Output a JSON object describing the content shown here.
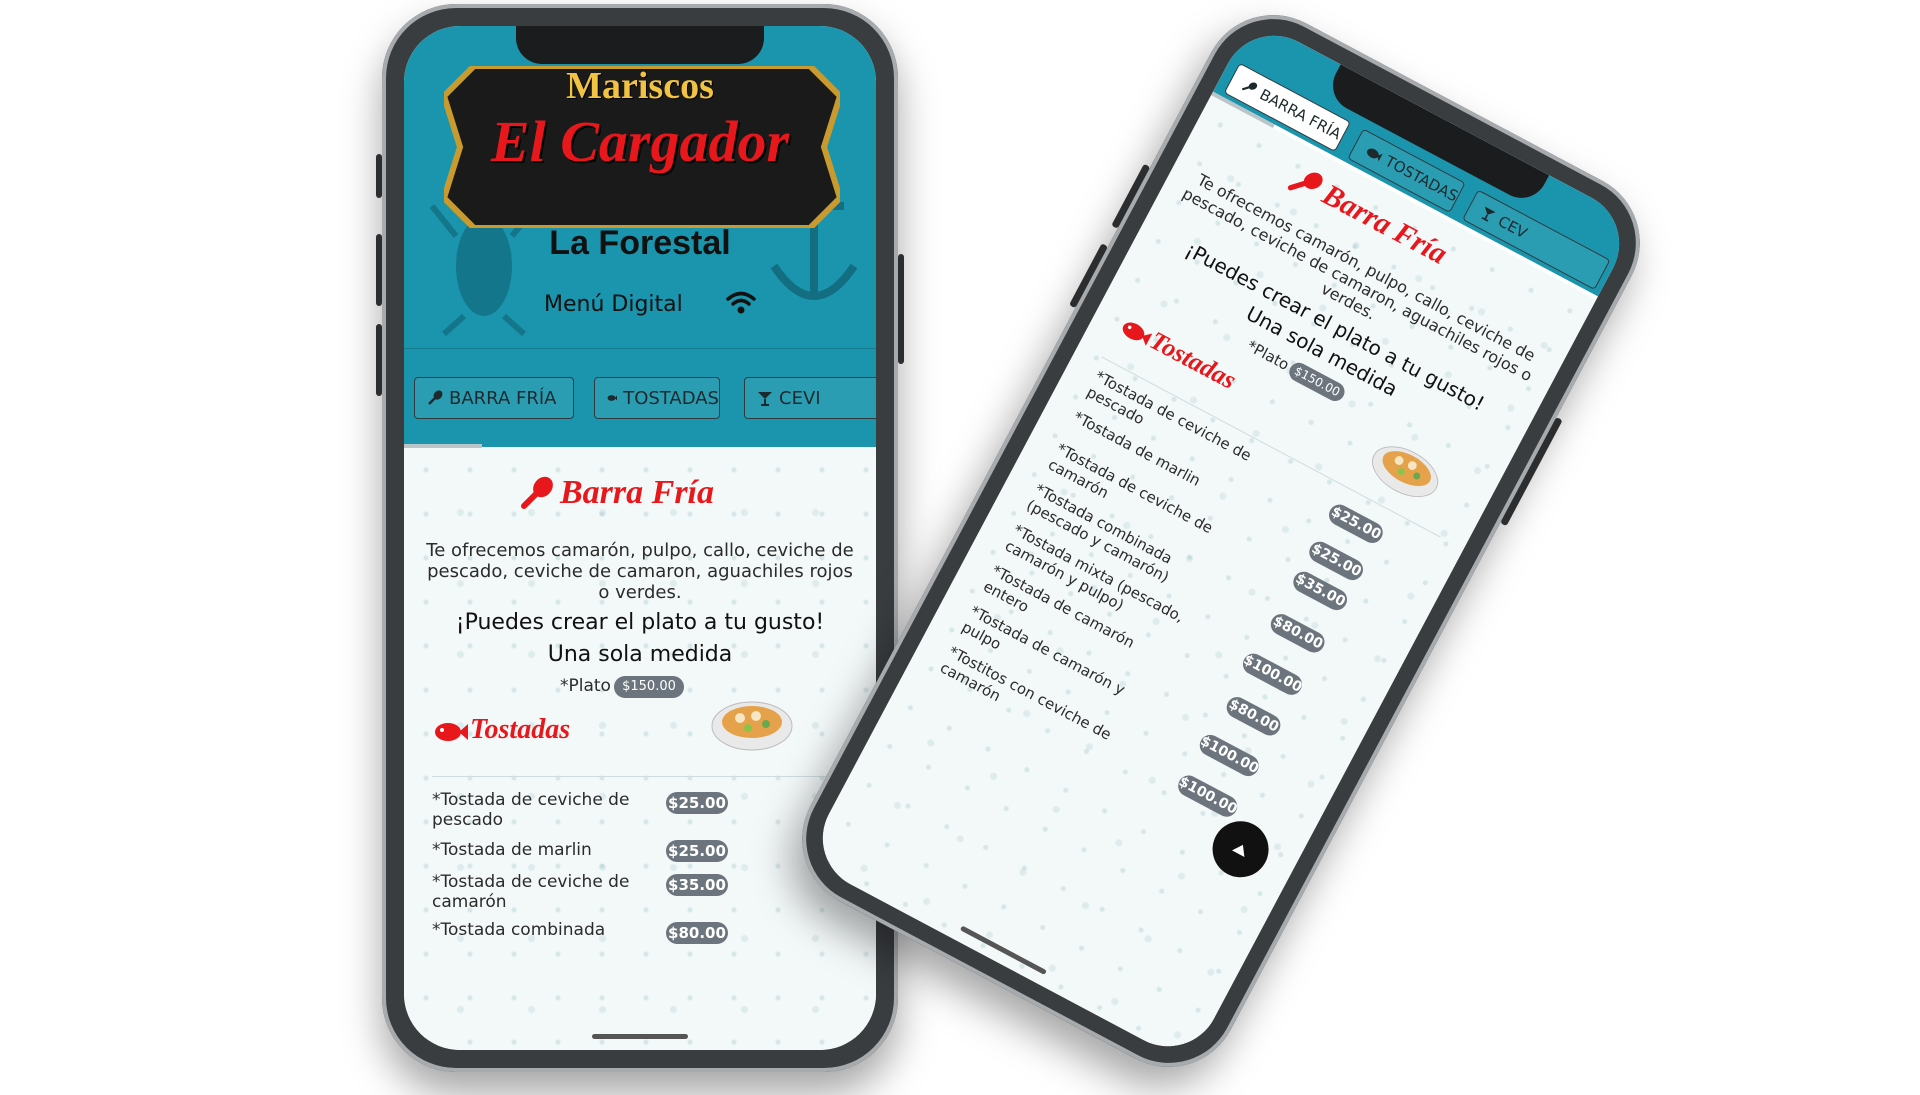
{
  "brand": {
    "line1": "Mariscos",
    "line2": "El Cargador",
    "line3": "La Forestal",
    "tagline": "Menú Digital"
  },
  "tabs": [
    {
      "label": "BARRA FRÍA",
      "icon": "spoon-icon"
    },
    {
      "label": "TOSTADAS",
      "icon": "fish-icon"
    },
    {
      "label": "CEVI",
      "icon": "cocktail-glass-icon"
    }
  ],
  "right_tabs": [
    {
      "label": "BARRA FRÍA",
      "icon": "spoon-icon"
    },
    {
      "label": "TOSTADAS",
      "icon": "fish-icon"
    },
    {
      "label": "CEV",
      "icon": "cocktail-glass-icon"
    }
  ],
  "barra_fria": {
    "title": "Barra Fría",
    "description": "Te ofrecemos camarón, pulpo, callo, ceviche de pescado, ceviche de camaron, aguachiles rojos o verdes.",
    "callout1": "¡Puedes crear el plato a tu gusto!",
    "callout2": "Una sola medida",
    "plate_label": "*Plato",
    "plate_price": "$150.00"
  },
  "tostadas": {
    "title": "Tostadas",
    "items": [
      {
        "name": "*Tostada de ceviche de pescado",
        "price": "$25.00"
      },
      {
        "name": "*Tostada de marlin",
        "price": "$25.00"
      },
      {
        "name": "*Tostada de ceviche de camarón",
        "price": "$35.00"
      },
      {
        "name": "*Tostada combinada (pescado y camarón)",
        "price": "$80.00"
      },
      {
        "name": "*Tostada mixta (pescado, camarón y pulpo)",
        "price": "$100.00"
      },
      {
        "name": "*Tostada de camarón entero",
        "price": "$80.00"
      },
      {
        "name": "*Tostada de camarón y pulpo",
        "price": "$100.00"
      },
      {
        "name": "*Tostitos con ceviche de camarón",
        "price": "$100.00"
      }
    ],
    "left_item4_visible": "*Tostada combinada"
  },
  "colors": {
    "header_teal": "#1a95ad",
    "accent_red": "#e8171c",
    "price_badge": "#6c757d",
    "logo_gold": "#f2c342"
  },
  "icons": {
    "wifi": "wifi-icon",
    "scroll_top": "arrow-up-icon"
  }
}
